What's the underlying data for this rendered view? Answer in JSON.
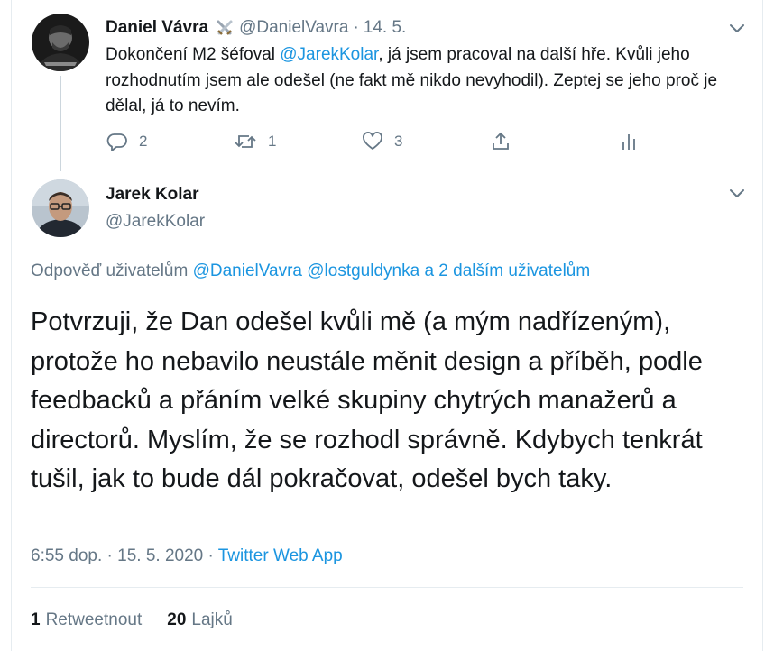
{
  "parent_tweet": {
    "author_name": "Daniel Vávra",
    "handle": "@DanielVavra",
    "separator": "·",
    "date": "14. 5.",
    "text_parts": {
      "before": "Dokončení M2 šéfoval ",
      "mention": "@JarekKolar",
      "after": ", já jsem pracoval na další  hře. Kvůli jeho rozhodnutím jsem ale odešel (ne fakt mě nikdo nevyhodil). Zeptej se jeho proč je dělal, já to nevím."
    },
    "actions": {
      "reply_count": "2",
      "retweet_count": "1",
      "like_count": "3"
    }
  },
  "main_tweet": {
    "author_name": "Jarek Kolar",
    "handle": "@JarekKolar",
    "replying": {
      "prefix": "Odpověď uživatelům ",
      "link": "@DanielVavra @lostguldynka a 2 dalším uživatelům"
    },
    "text": "Potvrzuji, že Dan odešel kvůli mě (a mým nadřízeným), protože ho nebavilo neustále měnit design a příběh, podle feedbacků a přáním velké skupiny chytrých manažerů a directorů. Myslím, že se rozhodl správně. Kdybych tenkrát tušil, jak to bude dál pokračovat, odešel bych taky.",
    "timestamp": "6:55 dop. · 15. 5. 2020 · ",
    "source": "Twitter Web App",
    "stats": {
      "retweets_count": "1",
      "retweets_label": "Retweetnout",
      "likes_count": "20",
      "likes_label": "Lajků"
    }
  },
  "colors": {
    "text": "#14171a",
    "secondary": "#657786",
    "link": "#1b95e0",
    "border": "#e6ecf0"
  },
  "icons": [
    "chevron-down-icon",
    "crossed-swords-emoji",
    "reply-icon",
    "retweet-icon",
    "like-icon",
    "share-icon",
    "analytics-icon"
  ]
}
